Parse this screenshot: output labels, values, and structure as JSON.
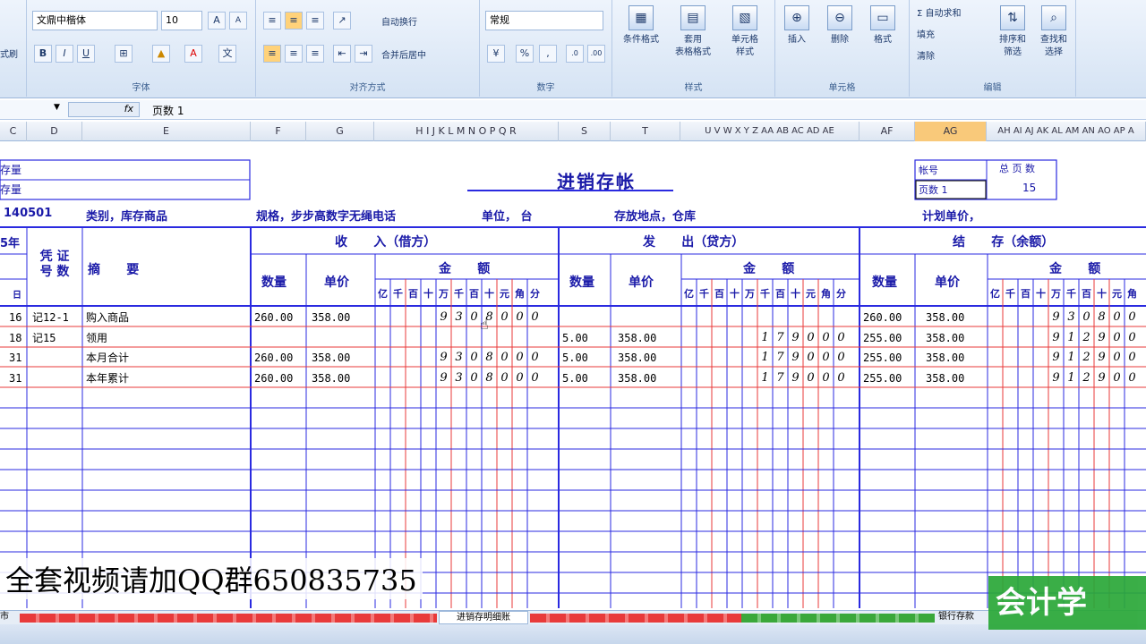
{
  "ribbon": {
    "font_name": "文鼎中楷体",
    "font_size": "10",
    "wrap_text": "自动换行",
    "merge_center": "合并后居中",
    "number_format": "常规",
    "groups": {
      "font": "字体",
      "align": "对齐方式",
      "number": "数字",
      "style": "样式",
      "cells": "单元格",
      "edit": "编辑"
    },
    "big": {
      "cond_format": "条件格式",
      "table_format": "套用\n表格格式",
      "cell_style": "单元格\n样式",
      "insert": "插入",
      "delete": "删除",
      "format": "格式",
      "sort_filter": "排序和\n筛选",
      "find_select": "查找和\n选择"
    },
    "small": {
      "autosum": "Σ 自动求和",
      "fill": "填充",
      "clear": "清除"
    }
  },
  "formula_bar": {
    "value": "页数 1"
  },
  "columns": [
    "C",
    "D",
    "E",
    "F",
    "G",
    "H I J K L M N O P Q R",
    "S",
    "T",
    "U V W X Y Z AA AB AC AD AE",
    "AF",
    "AG",
    "AH AI AJ AK AL AM AN AO AP A"
  ],
  "ledger": {
    "title": "进销存帐",
    "left_box": [
      "存量",
      "存量"
    ],
    "account_no": "140501",
    "category": "类别，库存商品",
    "spec": "规格，步步高数字无绳电话",
    "unit": "单位，  台",
    "location": "存放地点，仓库",
    "plan_price": "计划单价，",
    "right_box": {
      "acct_label": "帐号",
      "page_label": "页数 1",
      "total_pages_label": "总 页 数",
      "total_pages": "15"
    },
    "year": "5年",
    "voucher": "凭 证\n号 数",
    "day_label": "日",
    "summary_header": "摘      要",
    "sections": {
      "in": "收      入（借方）",
      "out": "发      出（贷方）",
      "bal": "结      存（余额）"
    },
    "qty": "数量",
    "price": "单价",
    "amount": "金      额",
    "digits": [
      "亿",
      "千",
      "百",
      "十",
      "万",
      "千",
      "百",
      "十",
      "元",
      "角",
      "分"
    ],
    "rows": [
      {
        "day": "16",
        "voucher": "记12-1",
        "summary": "购入商品",
        "in_qty": "260.00",
        "in_price": "358.00",
        "in_amt": [
          "",
          "",
          "",
          "",
          "9",
          "3",
          "0",
          "8",
          "0",
          "0",
          "0"
        ],
        "out_qty": "",
        "out_price": "",
        "out_amt": [
          "",
          "",
          "",
          "",
          "",
          "",
          "",
          "",
          "",
          "",
          ""
        ],
        "bal_qty": "260.00",
        "bal_price": "358.00",
        "bal_amt": [
          "",
          "",
          "",
          "",
          "9",
          "3",
          "0",
          "8",
          "0",
          "0"
        ]
      },
      {
        "day": "18",
        "voucher": "记15",
        "summary": "领用",
        "in_qty": "",
        "in_price": "",
        "in_amt": [
          "",
          "",
          "",
          "",
          "",
          "",
          "",
          "",
          "",
          "",
          ""
        ],
        "out_qty": "5.00",
        "out_price": "358.00",
        "out_amt": [
          "",
          "",
          "",
          "",
          "",
          "1",
          "7",
          "9",
          "0",
          "0",
          "0"
        ],
        "bal_qty": "255.00",
        "bal_price": "358.00",
        "bal_amt": [
          "",
          "",
          "",
          "",
          "9",
          "1",
          "2",
          "9",
          "0",
          "0"
        ]
      },
      {
        "day": "31",
        "voucher": "",
        "summary": "本月合计",
        "in_qty": "260.00",
        "in_price": "358.00",
        "in_amt": [
          "",
          "",
          "",
          "",
          "9",
          "3",
          "0",
          "8",
          "0",
          "0",
          "0"
        ],
        "out_qty": "5.00",
        "out_price": "358.00",
        "out_amt": [
          "",
          "",
          "",
          "",
          "",
          "1",
          "7",
          "9",
          "0",
          "0",
          "0"
        ],
        "bal_qty": "255.00",
        "bal_price": "358.00",
        "bal_amt": [
          "",
          "",
          "",
          "",
          "9",
          "1",
          "2",
          "9",
          "0",
          "0"
        ]
      },
      {
        "day": "31",
        "voucher": "",
        "summary": "本年累计",
        "in_qty": "260.00",
        "in_price": "358.00",
        "in_amt": [
          "",
          "",
          "",
          "",
          "9",
          "3",
          "0",
          "8",
          "0",
          "0",
          "0"
        ],
        "out_qty": "5.00",
        "out_price": "358.00",
        "out_amt": [
          "",
          "",
          "",
          "",
          "",
          "1",
          "7",
          "9",
          "0",
          "0",
          "0"
        ],
        "bal_qty": "255.00",
        "bal_price": "358.00",
        "bal_amt": [
          "",
          "",
          "",
          "",
          "9",
          "1",
          "2",
          "9",
          "0",
          "0"
        ]
      }
    ]
  },
  "tabs": [
    "市",
    "进销存明细账",
    "银行存款"
  ],
  "watermark": "全套视频请加QQ群650835735",
  "logo": "会计学",
  "colors": {
    "blue": "#2a2ae0",
    "red": "#e83a3a",
    "ribbon": "#dfe9f6"
  }
}
